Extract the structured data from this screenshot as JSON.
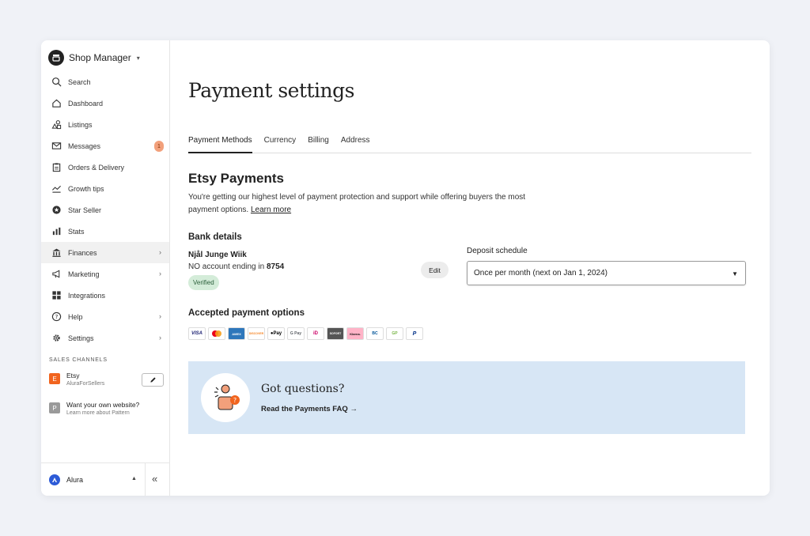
{
  "sidebar": {
    "title": "Shop Manager",
    "items": [
      {
        "label": "Search",
        "icon": "search-icon"
      },
      {
        "label": "Dashboard",
        "icon": "home-icon"
      },
      {
        "label": "Listings",
        "icon": "listings-icon"
      },
      {
        "label": "Messages",
        "icon": "mail-icon",
        "badge": "1"
      },
      {
        "label": "Orders & Delivery",
        "icon": "clipboard-icon"
      },
      {
        "label": "Growth tips",
        "icon": "growth-icon"
      },
      {
        "label": "Star Seller",
        "icon": "star-badge-icon"
      },
      {
        "label": "Stats",
        "icon": "bar-chart-icon"
      },
      {
        "label": "Finances",
        "icon": "bank-icon",
        "active": true
      },
      {
        "label": "Marketing",
        "icon": "megaphone-icon"
      },
      {
        "label": "Integrations",
        "icon": "grid-icon"
      },
      {
        "label": "Help",
        "icon": "help-icon"
      },
      {
        "label": "Settings",
        "icon": "gear-icon"
      }
    ],
    "sales_channels_label": "SALES CHANNELS",
    "channels": [
      {
        "letter": "E",
        "name": "Etsy",
        "sub": "AluraForSellers",
        "color": "#f1641e"
      },
      {
        "letter": "P",
        "name": "Want your own website?",
        "sub": "Learn more about Pattern",
        "color": "#9a9a9a"
      }
    ],
    "footer_user": "Alura",
    "avatar_color": "#2d5bd7"
  },
  "main": {
    "title": "Payment settings",
    "tabs": [
      "Payment Methods",
      "Currency",
      "Billing",
      "Address"
    ],
    "section_title": "Etsy Payments",
    "description": "You're getting our highest level of payment protection and support while offering buyers the most payment options.",
    "learn_more": "Learn more",
    "bank_heading": "Bank details",
    "account_name": "Njål Junge Wiik",
    "account_prefix": "NO account ending in",
    "account_last4": "8754",
    "verified_label": "Verified",
    "edit_label": "Edit",
    "deposit_label": "Deposit schedule",
    "deposit_value": "Once per month (next on Jan 1, 2024)",
    "options_heading": "Accepted payment options",
    "payment_options": [
      {
        "name": "visa-icon",
        "text": "VISA",
        "color": "#1a1f71"
      },
      {
        "name": "mastercard-icon",
        "text": "",
        "color": "#eb001b"
      },
      {
        "name": "amex-icon",
        "text": "AMEX",
        "color": "#2e77bb"
      },
      {
        "name": "discover-icon",
        "text": "DISCOVER",
        "color": "#f58220"
      },
      {
        "name": "apple-pay-icon",
        "text": "Pay",
        "color": "#000000"
      },
      {
        "name": "google-pay-icon",
        "text": "G Pay",
        "color": "#5f6368"
      },
      {
        "name": "ideal-icon",
        "text": "iD",
        "color": "#cc0066"
      },
      {
        "name": "sofort-icon",
        "text": "SOFORT",
        "color": "#555555"
      },
      {
        "name": "klarna-icon",
        "text": "Klarna.",
        "color": "#ffb3c7"
      },
      {
        "name": "bancontact-icon",
        "text": "BC",
        "color": "#005498"
      },
      {
        "name": "giropay-icon",
        "text": "GP",
        "color": "#7ab648"
      },
      {
        "name": "paypal-icon",
        "text": "P",
        "color": "#003087"
      }
    ],
    "faq_title": "Got questions?",
    "faq_link": "Read the Payments FAQ →"
  },
  "colors": {
    "faq_background": "#d7e6f5",
    "verified_background": "#d4ecd9",
    "badge": "#f2a07b"
  }
}
